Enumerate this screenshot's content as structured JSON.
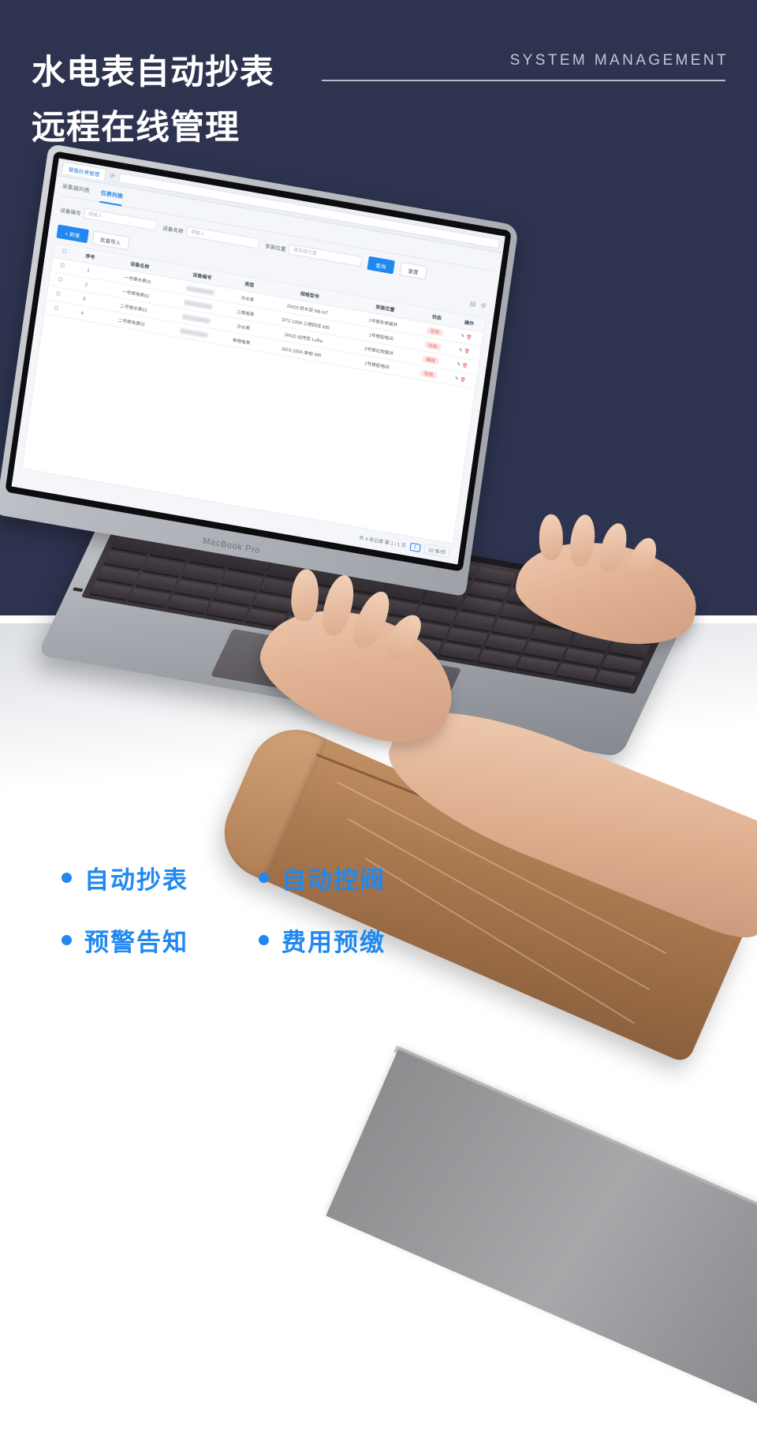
{
  "header": {
    "title_line1": "水电表自动抄表",
    "title_line2": "远程在线管理",
    "subtitle_en": "SYSTEM MANAGEMENT",
    "bg_color": "#2e3450",
    "title_color": "#ffffff",
    "subtitle_color": "#c3c7d4"
  },
  "laptop": {
    "brand": "MacBook Pro",
    "body_color": "#a9acb2"
  },
  "app": {
    "browser": {
      "tab_label": "智能抄表管理",
      "reload_icon": "refresh-icon",
      "address_value": ""
    },
    "tabs": [
      {
        "label": "采集器列表",
        "active": false
      },
      {
        "label": "仪表列表",
        "active": true
      }
    ],
    "filters": [
      {
        "label": "设备编号",
        "placeholder": "请输入",
        "value": ""
      },
      {
        "label": "设备名称",
        "placeholder": "请输入",
        "value": ""
      },
      {
        "label": "安装位置",
        "placeholder": "请选择位置",
        "value": ""
      }
    ],
    "filter_buttons": {
      "search": "查询",
      "reset": "重置",
      "search_icon": "search-icon"
    },
    "toolbar": {
      "add": "+ 新增",
      "import": "批量导入",
      "column_icon": "columns-icon",
      "settings_icon": "gear-icon"
    },
    "table": {
      "columns": [
        "",
        "序号",
        "设备名称",
        "设备编号",
        "类型",
        "规格型号",
        "安装位置",
        "状态",
        "操作"
      ],
      "rows": [
        {
          "index": "1",
          "name": "一号楼水表01",
          "code": "SB2023001",
          "type": "冷水表",
          "spec": "DN25 防水型 NB-IoT",
          "location": "1号楼东侧管井",
          "status": "在线",
          "ops_edit_icon": "edit-icon",
          "ops_delete_icon": "trash-icon"
        },
        {
          "index": "2",
          "name": "一号楼电表01",
          "code": "SB2023002",
          "type": "三相电表",
          "spec": "DTZ-100A 三相四线 485",
          "location": "1号楼配电间",
          "status": "在线",
          "ops_edit_icon": "edit-icon",
          "ops_delete_icon": "trash-icon"
        },
        {
          "index": "3",
          "name": "二号楼水表01",
          "code": "SB2023003",
          "type": "冷水表",
          "spec": "DN20 远传型 LoRa",
          "location": "2号楼北侧管井",
          "status": "离线",
          "ops_edit_icon": "edit-icon",
          "ops_delete_icon": "trash-icon"
        },
        {
          "index": "4",
          "name": "二号楼电表01",
          "code": "SB2023004",
          "type": "单相电表",
          "spec": "DDS-100A 单相 485",
          "location": "2号楼配电间",
          "status": "在线",
          "ops_edit_icon": "edit-icon",
          "ops_delete_icon": "trash-icon"
        }
      ]
    },
    "pagination": {
      "summary": "共 4 条记录 第 1 / 1 页",
      "current_page": "1",
      "page_size": "10 条/页"
    }
  },
  "features": [
    {
      "text": "自动抄表"
    },
    {
      "text": "自动控阀"
    },
    {
      "text": "预警告知"
    },
    {
      "text": "费用预缴"
    }
  ],
  "accent_color": "#2088f0"
}
